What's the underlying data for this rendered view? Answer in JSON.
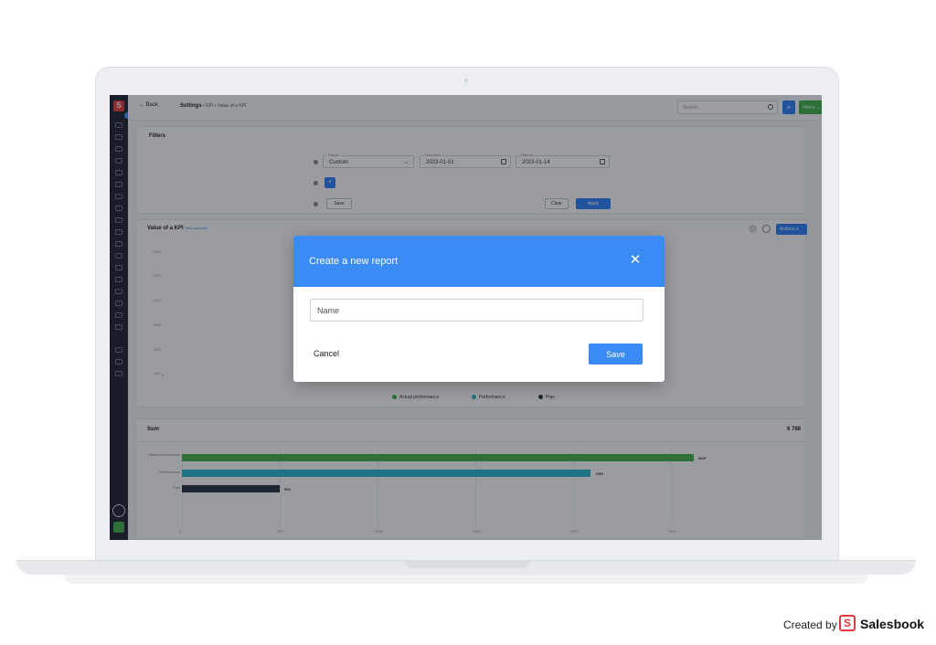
{
  "app": {
    "topbar": {
      "back_label": "Back",
      "breadcrumb_root": "Settings",
      "breadcrumb_rest": "• KPI • Value of a KPI",
      "search_placeholder": "Search...",
      "plus_label": "+",
      "filters_label": "Filters"
    },
    "filters": {
      "title": "Filters",
      "range_label": "Range",
      "range_value": "Custom",
      "date_from_label": "Data from",
      "date_from_value": "2023-01-01",
      "date_to_label": "Data to",
      "date_to_value": "2023-01-14",
      "add_label": "+",
      "save_label": "Save",
      "clear_label": "Clear",
      "apply_label": "Apply"
    },
    "chart_panel": {
      "title": "Value of a KPI",
      "link": "Find out more",
      "actions_label": "Actions",
      "yticks": [
        "3000",
        "2500",
        "2000",
        "1500",
        "1000",
        "500",
        "0"
      ],
      "legend": [
        "Actual performance",
        "Performance",
        "Plan"
      ]
    },
    "sum_panel": {
      "title": "Sum",
      "total": "6 788",
      "xticks": [
        "0",
        "500",
        "1000",
        "1500",
        "2000",
        "2500"
      ]
    }
  },
  "chart_data": {
    "type": "bar",
    "orientation": "horizontal",
    "title": "Sum",
    "categories": [
      "Actual performance",
      "Performance",
      "Plan"
    ],
    "values": [
      2687,
      2091,
      500
    ],
    "xlim": [
      0,
      2500
    ],
    "colors": [
      "#3fae49",
      "#26b5d0",
      "#2a3042"
    ]
  },
  "modal": {
    "title": "Create a new report",
    "name_placeholder": "Name",
    "cancel_label": "Cancel",
    "save_label": "Save"
  },
  "watermark": {
    "created_by": "Created by",
    "brand": "Salesbook"
  }
}
